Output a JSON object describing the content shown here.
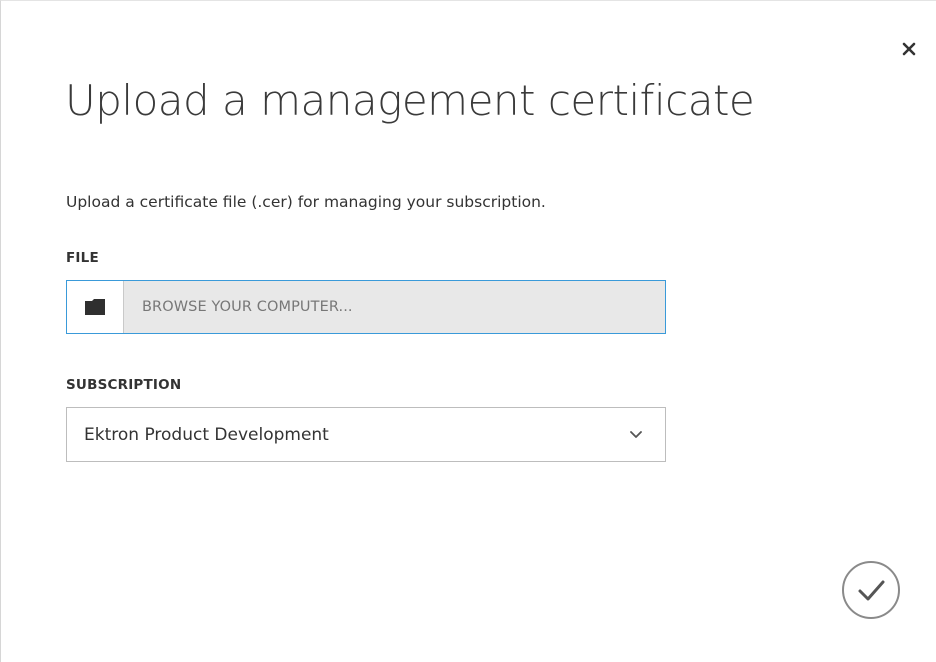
{
  "dialog": {
    "title": "Upload a management certificate",
    "description": "Upload a certificate file (.cer) for managing your subscription.",
    "close_icon": "close-icon",
    "confirm_icon": "checkmark-icon"
  },
  "file": {
    "label": "FILE",
    "placeholder": "BROWSE YOUR COMPUTER...",
    "icon": "folder-icon"
  },
  "subscription": {
    "label": "SUBSCRIPTION",
    "selected": "Ektron Product Development",
    "icon": "chevron-down-icon"
  },
  "colors": {
    "accent": "#3a9ad9",
    "text": "#333333",
    "input_fill": "#e8e8e8",
    "border": "#bdbdbd"
  }
}
